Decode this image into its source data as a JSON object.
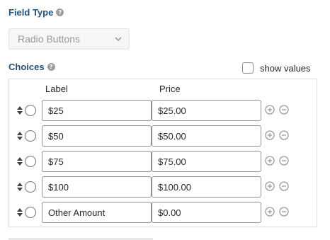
{
  "field_type": {
    "label": "Field Type",
    "help_icon": "question-circle-icon",
    "selected_value": "Radio Buttons"
  },
  "choices": {
    "label": "Choices",
    "help_icon": "question-circle-icon",
    "show_values_label": "show values",
    "show_values_checked": false,
    "columns": {
      "label": "Label",
      "price": "Price"
    },
    "rows": [
      {
        "label": "$25",
        "price": "$25.00"
      },
      {
        "label": "$50",
        "price": "$50.00"
      },
      {
        "label": "$75",
        "price": "$75.00"
      },
      {
        "label": "$100",
        "price": "$100.00"
      },
      {
        "label": "Other Amount",
        "price": "$0.00"
      }
    ]
  },
  "colors": {
    "heading": "#23527c",
    "icon_gray": "#9aa0a6"
  }
}
